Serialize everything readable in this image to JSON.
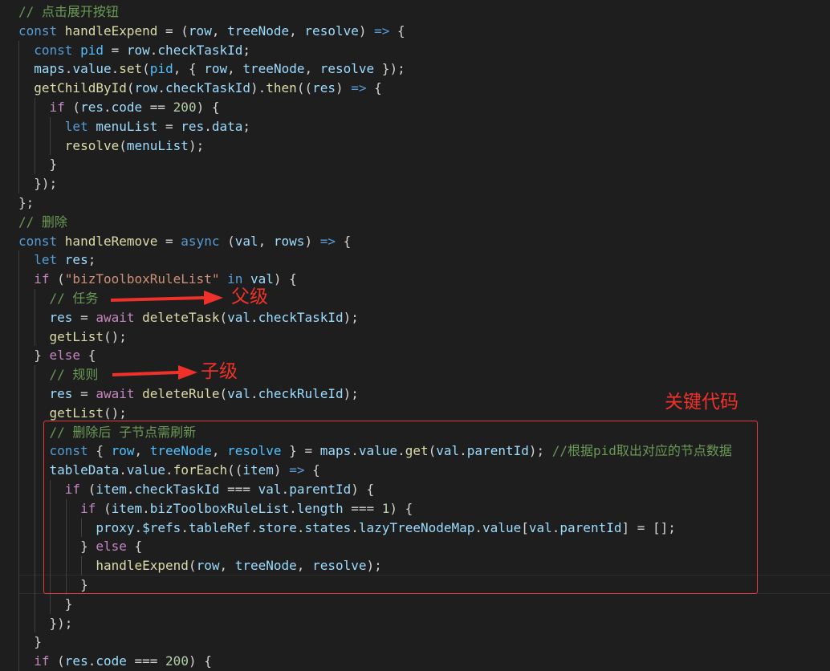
{
  "code_lines": [
    [
      {
        "t": "// 点击展开按钮",
        "c": "cm"
      }
    ],
    [
      {
        "t": "const ",
        "c": "kw"
      },
      {
        "t": "handleExpend",
        "c": "fn"
      },
      {
        "t": " = (",
        "c": "p"
      },
      {
        "t": "row",
        "c": "var"
      },
      {
        "t": ", ",
        "c": "p"
      },
      {
        "t": "treeNode",
        "c": "var"
      },
      {
        "t": ", ",
        "c": "p"
      },
      {
        "t": "resolve",
        "c": "var"
      },
      {
        "t": ") ",
        "c": "p"
      },
      {
        "t": "=>",
        "c": "kw"
      },
      {
        "t": " {",
        "c": "p"
      }
    ],
    [
      {
        "t": "  const ",
        "c": "kw"
      },
      {
        "t": "pid",
        "c": "con"
      },
      {
        "t": " = ",
        "c": "p"
      },
      {
        "t": "row",
        "c": "var"
      },
      {
        "t": ".",
        "c": "p"
      },
      {
        "t": "checkTaskId",
        "c": "var"
      },
      {
        "t": ";",
        "c": "p"
      }
    ],
    [
      {
        "t": "  maps",
        "c": "var"
      },
      {
        "t": ".",
        "c": "p"
      },
      {
        "t": "value",
        "c": "var"
      },
      {
        "t": ".",
        "c": "p"
      },
      {
        "t": "set",
        "c": "fn"
      },
      {
        "t": "(",
        "c": "p"
      },
      {
        "t": "pid",
        "c": "con"
      },
      {
        "t": ", { ",
        "c": "p"
      },
      {
        "t": "row",
        "c": "var"
      },
      {
        "t": ", ",
        "c": "p"
      },
      {
        "t": "treeNode",
        "c": "var"
      },
      {
        "t": ", ",
        "c": "p"
      },
      {
        "t": "resolve",
        "c": "var"
      },
      {
        "t": " });",
        "c": "p"
      }
    ],
    [
      {
        "t": "  getChildById",
        "c": "fn"
      },
      {
        "t": "(",
        "c": "p"
      },
      {
        "t": "row",
        "c": "var"
      },
      {
        "t": ".",
        "c": "p"
      },
      {
        "t": "checkTaskId",
        "c": "var"
      },
      {
        "t": ").",
        "c": "p"
      },
      {
        "t": "then",
        "c": "fn"
      },
      {
        "t": "((",
        "c": "p"
      },
      {
        "t": "res",
        "c": "var"
      },
      {
        "t": ") ",
        "c": "p"
      },
      {
        "t": "=>",
        "c": "kw"
      },
      {
        "t": " {",
        "c": "p"
      }
    ],
    [
      {
        "t": "    if",
        "c": "cf"
      },
      {
        "t": " (",
        "c": "p"
      },
      {
        "t": "res",
        "c": "var"
      },
      {
        "t": ".",
        "c": "p"
      },
      {
        "t": "code",
        "c": "var"
      },
      {
        "t": " == ",
        "c": "p"
      },
      {
        "t": "200",
        "c": "num"
      },
      {
        "t": ") {",
        "c": "p"
      }
    ],
    [
      {
        "t": "      let ",
        "c": "kw"
      },
      {
        "t": "menuList",
        "c": "var"
      },
      {
        "t": " = ",
        "c": "p"
      },
      {
        "t": "res",
        "c": "var"
      },
      {
        "t": ".",
        "c": "p"
      },
      {
        "t": "data",
        "c": "var"
      },
      {
        "t": ";",
        "c": "p"
      }
    ],
    [
      {
        "t": "      resolve",
        "c": "fn"
      },
      {
        "t": "(",
        "c": "p"
      },
      {
        "t": "menuList",
        "c": "var"
      },
      {
        "t": ");",
        "c": "p"
      }
    ],
    [
      {
        "t": "    }",
        "c": "p"
      }
    ],
    [
      {
        "t": "  });",
        "c": "p"
      }
    ],
    [
      {
        "t": "};",
        "c": "p"
      }
    ],
    [
      {
        "t": "// 删除",
        "c": "cm"
      }
    ],
    [
      {
        "t": "const ",
        "c": "kw"
      },
      {
        "t": "handleRemove",
        "c": "fn"
      },
      {
        "t": " = ",
        "c": "p"
      },
      {
        "t": "async",
        "c": "kw"
      },
      {
        "t": " (",
        "c": "p"
      },
      {
        "t": "val",
        "c": "var"
      },
      {
        "t": ", ",
        "c": "p"
      },
      {
        "t": "rows",
        "c": "var"
      },
      {
        "t": ") ",
        "c": "p"
      },
      {
        "t": "=>",
        "c": "kw"
      },
      {
        "t": " {",
        "c": "p"
      }
    ],
    [
      {
        "t": "  let ",
        "c": "kw"
      },
      {
        "t": "res",
        "c": "var"
      },
      {
        "t": ";",
        "c": "p"
      }
    ],
    [
      {
        "t": "  if",
        "c": "cf"
      },
      {
        "t": " (",
        "c": "p"
      },
      {
        "t": "\"bizToolboxRuleList\"",
        "c": "str"
      },
      {
        "t": " in ",
        "c": "kw"
      },
      {
        "t": "val",
        "c": "var"
      },
      {
        "t": ") {",
        "c": "p"
      }
    ],
    [
      {
        "t": "    // 任务",
        "c": "cm"
      }
    ],
    [
      {
        "t": "    res",
        "c": "var"
      },
      {
        "t": " = ",
        "c": "p"
      },
      {
        "t": "await ",
        "c": "cf"
      },
      {
        "t": "deleteTask",
        "c": "fn"
      },
      {
        "t": "(",
        "c": "p"
      },
      {
        "t": "val",
        "c": "var"
      },
      {
        "t": ".",
        "c": "p"
      },
      {
        "t": "checkTaskId",
        "c": "var"
      },
      {
        "t": ");",
        "c": "p"
      }
    ],
    [
      {
        "t": "    getList",
        "c": "fn"
      },
      {
        "t": "();",
        "c": "p"
      }
    ],
    [
      {
        "t": "  } ",
        "c": "p"
      },
      {
        "t": "else",
        "c": "cf"
      },
      {
        "t": " {",
        "c": "p"
      }
    ],
    [
      {
        "t": "    // 规则",
        "c": "cm"
      }
    ],
    [
      {
        "t": "    res",
        "c": "var"
      },
      {
        "t": " = ",
        "c": "p"
      },
      {
        "t": "await ",
        "c": "cf"
      },
      {
        "t": "deleteRule",
        "c": "fn"
      },
      {
        "t": "(",
        "c": "p"
      },
      {
        "t": "val",
        "c": "var"
      },
      {
        "t": ".",
        "c": "p"
      },
      {
        "t": "checkRuleId",
        "c": "var"
      },
      {
        "t": ");",
        "c": "p"
      }
    ],
    [
      {
        "t": "    getList",
        "c": "fn"
      },
      {
        "t": "();",
        "c": "p"
      }
    ],
    [
      {
        "t": "    // 删除后 子节点需刷新",
        "c": "cm"
      }
    ],
    [
      {
        "t": "    const",
        "c": "kw"
      },
      {
        "t": " { ",
        "c": "p"
      },
      {
        "t": "row",
        "c": "con"
      },
      {
        "t": ", ",
        "c": "p"
      },
      {
        "t": "treeNode",
        "c": "con"
      },
      {
        "t": ", ",
        "c": "p"
      },
      {
        "t": "resolve",
        "c": "con"
      },
      {
        "t": " } = ",
        "c": "p"
      },
      {
        "t": "maps",
        "c": "var"
      },
      {
        "t": ".",
        "c": "p"
      },
      {
        "t": "value",
        "c": "var"
      },
      {
        "t": ".",
        "c": "p"
      },
      {
        "t": "get",
        "c": "fn"
      },
      {
        "t": "(",
        "c": "p"
      },
      {
        "t": "val",
        "c": "var"
      },
      {
        "t": ".",
        "c": "p"
      },
      {
        "t": "parentId",
        "c": "var"
      },
      {
        "t": "); ",
        "c": "p"
      },
      {
        "t": "//根据pid取出对应的节点数据",
        "c": "cm"
      }
    ],
    [
      {
        "t": "    tableData",
        "c": "var"
      },
      {
        "t": ".",
        "c": "p"
      },
      {
        "t": "value",
        "c": "var"
      },
      {
        "t": ".",
        "c": "p"
      },
      {
        "t": "forEach",
        "c": "fn"
      },
      {
        "t": "((",
        "c": "p"
      },
      {
        "t": "item",
        "c": "var"
      },
      {
        "t": ") ",
        "c": "p"
      },
      {
        "t": "=>",
        "c": "kw"
      },
      {
        "t": " {",
        "c": "p"
      }
    ],
    [
      {
        "t": "      if",
        "c": "cf"
      },
      {
        "t": " (",
        "c": "p"
      },
      {
        "t": "item",
        "c": "var"
      },
      {
        "t": ".",
        "c": "p"
      },
      {
        "t": "checkTaskId",
        "c": "var"
      },
      {
        "t": " === ",
        "c": "p"
      },
      {
        "t": "val",
        "c": "var"
      },
      {
        "t": ".",
        "c": "p"
      },
      {
        "t": "parentId",
        "c": "var"
      },
      {
        "t": ") {",
        "c": "p"
      }
    ],
    [
      {
        "t": "        if",
        "c": "cf"
      },
      {
        "t": " (",
        "c": "p"
      },
      {
        "t": "item",
        "c": "var"
      },
      {
        "t": ".",
        "c": "p"
      },
      {
        "t": "bizToolboxRuleList",
        "c": "var"
      },
      {
        "t": ".",
        "c": "p"
      },
      {
        "t": "length",
        "c": "var"
      },
      {
        "t": " === ",
        "c": "p"
      },
      {
        "t": "1",
        "c": "num"
      },
      {
        "t": ") {",
        "c": "p"
      }
    ],
    [
      {
        "t": "          proxy",
        "c": "var"
      },
      {
        "t": ".",
        "c": "p"
      },
      {
        "t": "$refs",
        "c": "var"
      },
      {
        "t": ".",
        "c": "p"
      },
      {
        "t": "tableRef",
        "c": "var"
      },
      {
        "t": ".",
        "c": "p"
      },
      {
        "t": "store",
        "c": "var"
      },
      {
        "t": ".",
        "c": "p"
      },
      {
        "t": "states",
        "c": "var"
      },
      {
        "t": ".",
        "c": "p"
      },
      {
        "t": "lazyTreeNodeMap",
        "c": "var"
      },
      {
        "t": ".",
        "c": "p"
      },
      {
        "t": "value",
        "c": "var"
      },
      {
        "t": "[",
        "c": "p"
      },
      {
        "t": "val",
        "c": "var"
      },
      {
        "t": ".",
        "c": "p"
      },
      {
        "t": "parentId",
        "c": "var"
      },
      {
        "t": "] = [];",
        "c": "p"
      }
    ],
    [
      {
        "t": "        } ",
        "c": "p"
      },
      {
        "t": "else",
        "c": "cf"
      },
      {
        "t": " {",
        "c": "p"
      }
    ],
    [
      {
        "t": "          handleExpend",
        "c": "fn"
      },
      {
        "t": "(",
        "c": "p"
      },
      {
        "t": "row",
        "c": "var"
      },
      {
        "t": ", ",
        "c": "p"
      },
      {
        "t": "treeNode",
        "c": "var"
      },
      {
        "t": ", ",
        "c": "p"
      },
      {
        "t": "resolve",
        "c": "var"
      },
      {
        "t": ");",
        "c": "p"
      }
    ],
    [
      {
        "t": "        }",
        "c": "p"
      }
    ],
    [
      {
        "t": "      }",
        "c": "p"
      }
    ],
    [
      {
        "t": "    });",
        "c": "p"
      }
    ],
    [
      {
        "t": "  }",
        "c": "p"
      }
    ],
    [
      {
        "t": "  if",
        "c": "cf"
      },
      {
        "t": " (",
        "c": "p"
      },
      {
        "t": "res",
        "c": "var"
      },
      {
        "t": ".",
        "c": "p"
      },
      {
        "t": "code",
        "c": "var"
      },
      {
        "t": " === ",
        "c": "p"
      },
      {
        "t": "200",
        "c": "num"
      },
      {
        "t": ") {",
        "c": "p"
      }
    ]
  ],
  "annotations": {
    "parent_label": "父级",
    "child_label": "子级",
    "key_code_label": "关键代码",
    "color": "#f0312a"
  }
}
